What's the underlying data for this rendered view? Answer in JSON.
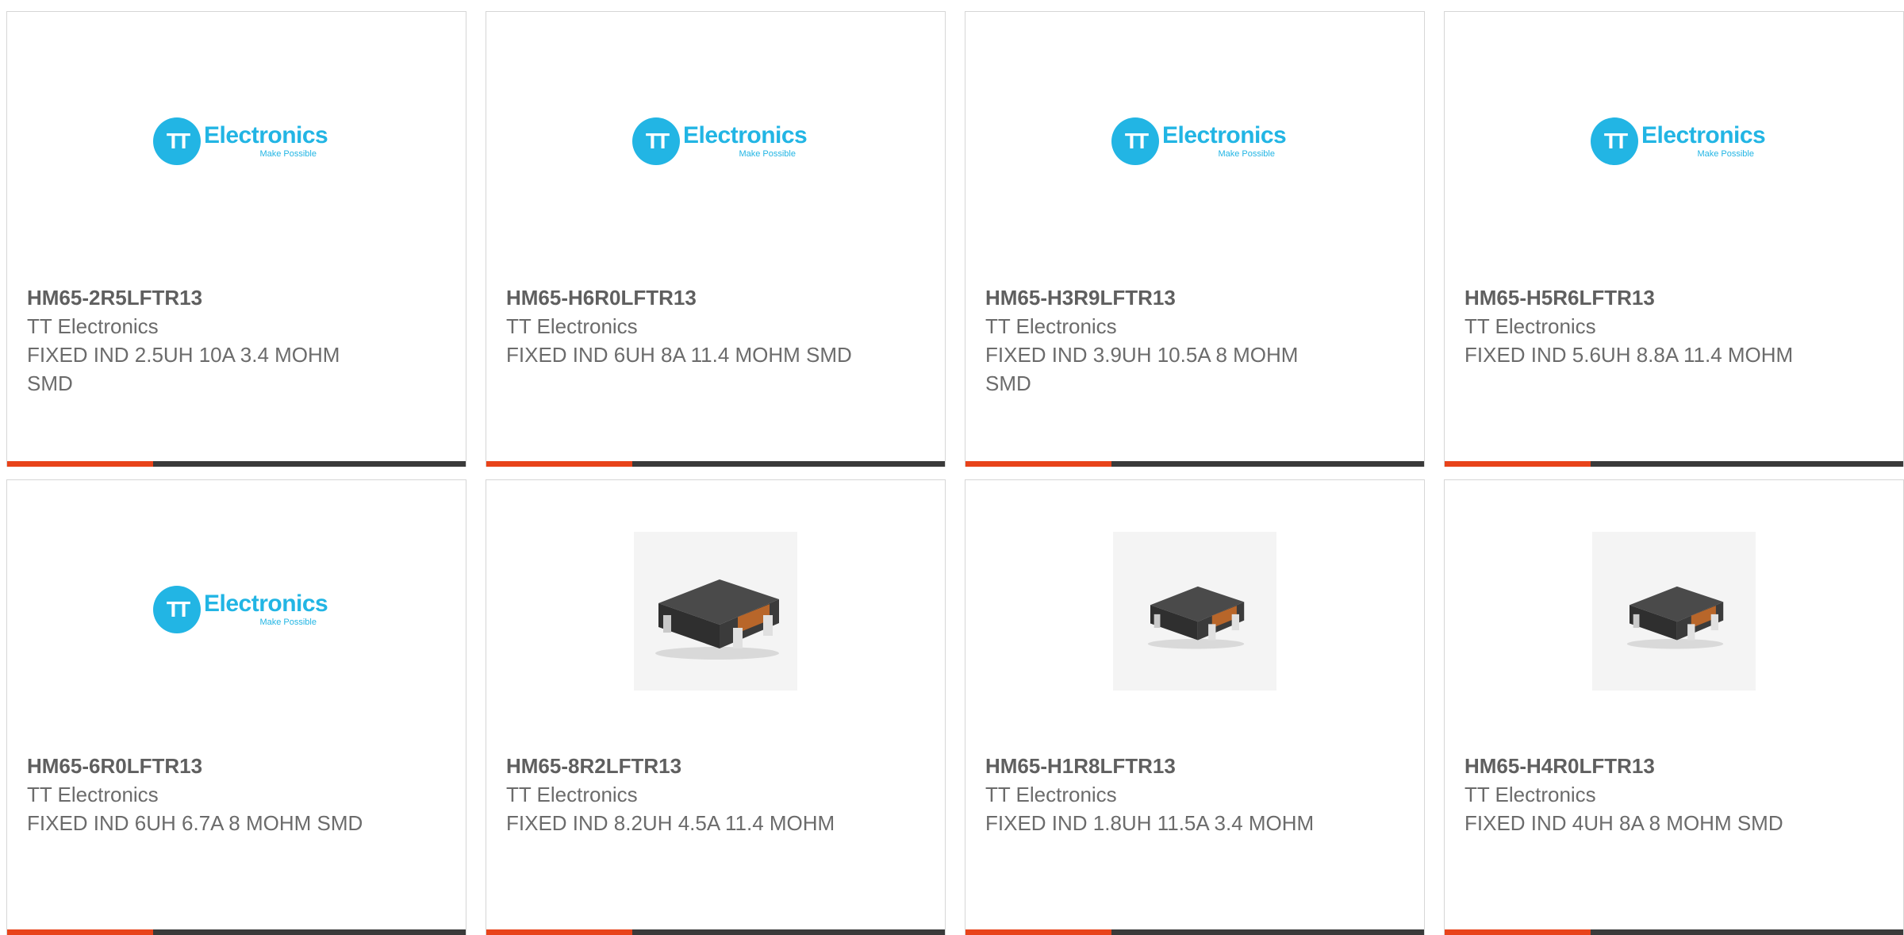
{
  "colors": {
    "accent_bar": "#e8431a",
    "dark_bar": "#3a3a3a",
    "logo_blue": "#22b5e4",
    "card_border": "#d6d6d6",
    "text": "#6b6b6b"
  },
  "brand_logo": {
    "circle_text": "TT",
    "wordmark": "Electronics",
    "tagline": "Make Possible"
  },
  "products": [
    {
      "part_number": "HM65-2R5LFTR13",
      "manufacturer": "TT Electronics",
      "description": "FIXED IND 2.5UH 10A 3.4 MOHM SMD",
      "image": "brand-logo"
    },
    {
      "part_number": "HM65-H6R0LFTR13",
      "manufacturer": "TT Electronics",
      "description": "FIXED IND 6UH 8A 11.4 MOHM SMD",
      "image": "brand-logo"
    },
    {
      "part_number": "HM65-H3R9LFTR13",
      "manufacturer": "TT Electronics",
      "description": "FIXED IND 3.9UH 10.5A 8 MOHM SMD",
      "image": "brand-logo"
    },
    {
      "part_number": "HM65-H5R6LFTR13",
      "manufacturer": "TT Electronics",
      "description": "FIXED IND 5.6UH 8.8A 11.4 MOHM",
      "image": "brand-logo"
    },
    {
      "part_number": "HM65-6R0LFTR13",
      "manufacturer": "TT Electronics",
      "description": "FIXED IND 6UH 6.7A 8 MOHM SMD",
      "image": "brand-logo"
    },
    {
      "part_number": "HM65-8R2LFTR13",
      "manufacturer": "TT Electronics",
      "description": "FIXED IND 8.2UH 4.5A 11.4 MOHM",
      "image": "inductor-photo-large"
    },
    {
      "part_number": "HM65-H1R8LFTR13",
      "manufacturer": "TT Electronics",
      "description": "FIXED IND 1.8UH 11.5A 3.4 MOHM",
      "image": "inductor-photo-small"
    },
    {
      "part_number": "HM65-H4R0LFTR13",
      "manufacturer": "TT Electronics",
      "description": "FIXED IND 4UH 8A 8 MOHM SMD",
      "image": "inductor-photo-small"
    }
  ]
}
